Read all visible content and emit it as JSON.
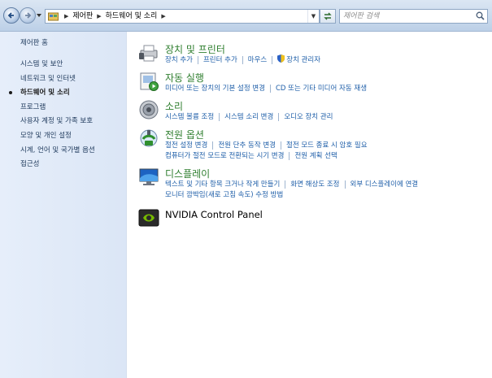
{
  "address_bar": {
    "breadcrumbs": [
      "제어판",
      "하드웨어 및 소리"
    ],
    "search_placeholder": "제어판 검색"
  },
  "sidebar": {
    "items": [
      {
        "label": "제어판 홈",
        "current": false
      },
      {
        "label": "시스템 및 보안",
        "current": false
      },
      {
        "label": "네트워크 및 인터넷",
        "current": false
      },
      {
        "label": "하드웨어 및 소리",
        "current": true
      },
      {
        "label": "프로그램",
        "current": false
      },
      {
        "label": "사용자 계정 및 가족 보호",
        "current": false
      },
      {
        "label": "모양 및 개인 설정",
        "current": false
      },
      {
        "label": "시계, 언어 및 국가별 옵션",
        "current": false
      },
      {
        "label": "접근성",
        "current": false
      }
    ]
  },
  "categories": [
    {
      "title": "장치 및 프린터",
      "icon": "printer-icon",
      "links": [
        [
          "장치 추가",
          "프린터 추가",
          "마우스",
          "장치 관리자"
        ]
      ]
    },
    {
      "title": "자동 실행",
      "icon": "autoplay-icon",
      "links": [
        [
          "미디어 또는 장치의 기본 설정 변경",
          "CD 또는 기타 미디어 자동 재생"
        ]
      ]
    },
    {
      "title": "소리",
      "icon": "speaker-icon",
      "links": [
        [
          "시스템 볼륨 조정",
          "시스템 소리 변경",
          "오디오 장치 관리"
        ]
      ]
    },
    {
      "title": "전원 옵션",
      "icon": "power-options-icon",
      "links": [
        [
          "절전 설정 변경",
          "전원 단추 동작 변경",
          "절전 모드 종료 시 암호 필요"
        ],
        [
          "컴퓨터가 절전 모드로 전환되는 시기 변경",
          "전원 계획 선택"
        ]
      ]
    },
    {
      "title": "디스플레이",
      "icon": "monitor-icon",
      "links": [
        [
          "텍스트 및 기타 항목 크거나 작게 만들기",
          "화면 해상도 조정",
          "외부 디스플레이에 연결"
        ],
        [
          "모니터 깜박임(새로 고침 속도) 수정 방법"
        ]
      ]
    },
    {
      "title": "NVIDIA Control Panel",
      "icon": "nvidia-icon",
      "links": []
    }
  ],
  "colors": {
    "category_title": "#2e7e2e",
    "link": "#1e5ea8",
    "sidebar_bg": "#e3ecf8"
  }
}
